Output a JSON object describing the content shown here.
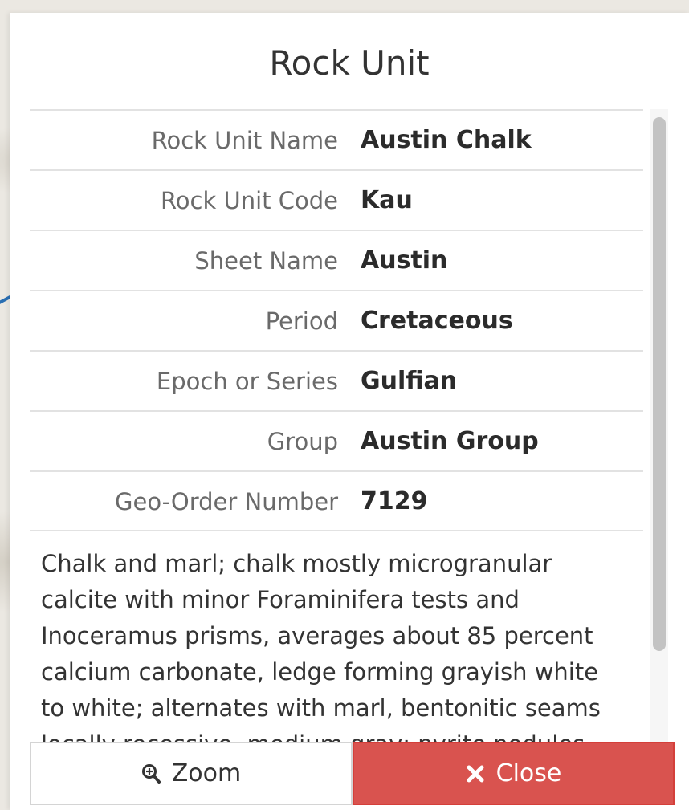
{
  "dialog": {
    "title": "Rock Unit"
  },
  "attributes": [
    {
      "label": "Rock Unit Name",
      "value": "Austin Chalk"
    },
    {
      "label": "Rock Unit Code",
      "value": "Kau"
    },
    {
      "label": "Sheet Name",
      "value": "Austin"
    },
    {
      "label": "Period",
      "value": "Cretaceous"
    },
    {
      "label": "Epoch or Series",
      "value": "Gulfian"
    },
    {
      "label": "Group",
      "value": "Austin Group"
    },
    {
      "label": "Geo-Order Number",
      "value": "7129"
    }
  ],
  "description": {
    "lines": [
      "Chalk and marl; chalk mostly microgranular",
      "calcite with minor Foraminifera tests and",
      "Inoceramus prisms, averages about 85 percent",
      "calcium carbonate, ledge forming grayish white",
      "to white; alternates with marl, bentonitic seams",
      "locally recessive, medium gray; pyrite nodules"
    ]
  },
  "buttons": {
    "zoom_label": "Zoom",
    "zoom_icon": "magnifier-zoom-icon",
    "close_label": "Close",
    "close_icon": "x-close-icon"
  },
  "colors": {
    "close_button": "#d9534f",
    "map_line": "#2a6fb3"
  }
}
